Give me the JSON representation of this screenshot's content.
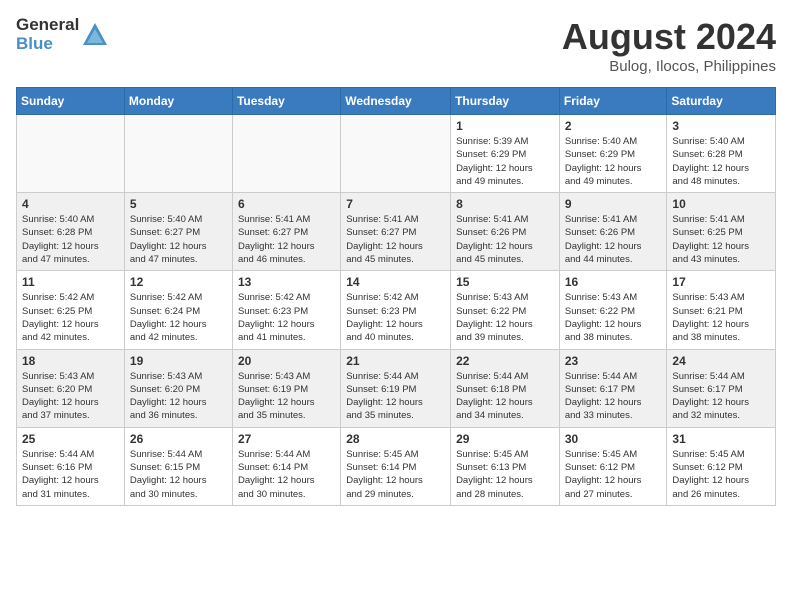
{
  "header": {
    "logo_general": "General",
    "logo_blue": "Blue",
    "month_year": "August 2024",
    "location": "Bulog, Ilocos, Philippines"
  },
  "weekdays": [
    "Sunday",
    "Monday",
    "Tuesday",
    "Wednesday",
    "Thursday",
    "Friday",
    "Saturday"
  ],
  "weeks": [
    [
      {
        "day": "",
        "info": ""
      },
      {
        "day": "",
        "info": ""
      },
      {
        "day": "",
        "info": ""
      },
      {
        "day": "",
        "info": ""
      },
      {
        "day": "1",
        "info": "Sunrise: 5:39 AM\nSunset: 6:29 PM\nDaylight: 12 hours\nand 49 minutes."
      },
      {
        "day": "2",
        "info": "Sunrise: 5:40 AM\nSunset: 6:29 PM\nDaylight: 12 hours\nand 49 minutes."
      },
      {
        "day": "3",
        "info": "Sunrise: 5:40 AM\nSunset: 6:28 PM\nDaylight: 12 hours\nand 48 minutes."
      }
    ],
    [
      {
        "day": "4",
        "info": "Sunrise: 5:40 AM\nSunset: 6:28 PM\nDaylight: 12 hours\nand 47 minutes."
      },
      {
        "day": "5",
        "info": "Sunrise: 5:40 AM\nSunset: 6:27 PM\nDaylight: 12 hours\nand 47 minutes."
      },
      {
        "day": "6",
        "info": "Sunrise: 5:41 AM\nSunset: 6:27 PM\nDaylight: 12 hours\nand 46 minutes."
      },
      {
        "day": "7",
        "info": "Sunrise: 5:41 AM\nSunset: 6:27 PM\nDaylight: 12 hours\nand 45 minutes."
      },
      {
        "day": "8",
        "info": "Sunrise: 5:41 AM\nSunset: 6:26 PM\nDaylight: 12 hours\nand 45 minutes."
      },
      {
        "day": "9",
        "info": "Sunrise: 5:41 AM\nSunset: 6:26 PM\nDaylight: 12 hours\nand 44 minutes."
      },
      {
        "day": "10",
        "info": "Sunrise: 5:41 AM\nSunset: 6:25 PM\nDaylight: 12 hours\nand 43 minutes."
      }
    ],
    [
      {
        "day": "11",
        "info": "Sunrise: 5:42 AM\nSunset: 6:25 PM\nDaylight: 12 hours\nand 42 minutes."
      },
      {
        "day": "12",
        "info": "Sunrise: 5:42 AM\nSunset: 6:24 PM\nDaylight: 12 hours\nand 42 minutes."
      },
      {
        "day": "13",
        "info": "Sunrise: 5:42 AM\nSunset: 6:23 PM\nDaylight: 12 hours\nand 41 minutes."
      },
      {
        "day": "14",
        "info": "Sunrise: 5:42 AM\nSunset: 6:23 PM\nDaylight: 12 hours\nand 40 minutes."
      },
      {
        "day": "15",
        "info": "Sunrise: 5:43 AM\nSunset: 6:22 PM\nDaylight: 12 hours\nand 39 minutes."
      },
      {
        "day": "16",
        "info": "Sunrise: 5:43 AM\nSunset: 6:22 PM\nDaylight: 12 hours\nand 38 minutes."
      },
      {
        "day": "17",
        "info": "Sunrise: 5:43 AM\nSunset: 6:21 PM\nDaylight: 12 hours\nand 38 minutes."
      }
    ],
    [
      {
        "day": "18",
        "info": "Sunrise: 5:43 AM\nSunset: 6:20 PM\nDaylight: 12 hours\nand 37 minutes."
      },
      {
        "day": "19",
        "info": "Sunrise: 5:43 AM\nSunset: 6:20 PM\nDaylight: 12 hours\nand 36 minutes."
      },
      {
        "day": "20",
        "info": "Sunrise: 5:43 AM\nSunset: 6:19 PM\nDaylight: 12 hours\nand 35 minutes."
      },
      {
        "day": "21",
        "info": "Sunrise: 5:44 AM\nSunset: 6:19 PM\nDaylight: 12 hours\nand 35 minutes."
      },
      {
        "day": "22",
        "info": "Sunrise: 5:44 AM\nSunset: 6:18 PM\nDaylight: 12 hours\nand 34 minutes."
      },
      {
        "day": "23",
        "info": "Sunrise: 5:44 AM\nSunset: 6:17 PM\nDaylight: 12 hours\nand 33 minutes."
      },
      {
        "day": "24",
        "info": "Sunrise: 5:44 AM\nSunset: 6:17 PM\nDaylight: 12 hours\nand 32 minutes."
      }
    ],
    [
      {
        "day": "25",
        "info": "Sunrise: 5:44 AM\nSunset: 6:16 PM\nDaylight: 12 hours\nand 31 minutes."
      },
      {
        "day": "26",
        "info": "Sunrise: 5:44 AM\nSunset: 6:15 PM\nDaylight: 12 hours\nand 30 minutes."
      },
      {
        "day": "27",
        "info": "Sunrise: 5:44 AM\nSunset: 6:14 PM\nDaylight: 12 hours\nand 30 minutes."
      },
      {
        "day": "28",
        "info": "Sunrise: 5:45 AM\nSunset: 6:14 PM\nDaylight: 12 hours\nand 29 minutes."
      },
      {
        "day": "29",
        "info": "Sunrise: 5:45 AM\nSunset: 6:13 PM\nDaylight: 12 hours\nand 28 minutes."
      },
      {
        "day": "30",
        "info": "Sunrise: 5:45 AM\nSunset: 6:12 PM\nDaylight: 12 hours\nand 27 minutes."
      },
      {
        "day": "31",
        "info": "Sunrise: 5:45 AM\nSunset: 6:12 PM\nDaylight: 12 hours\nand 26 minutes."
      }
    ]
  ]
}
